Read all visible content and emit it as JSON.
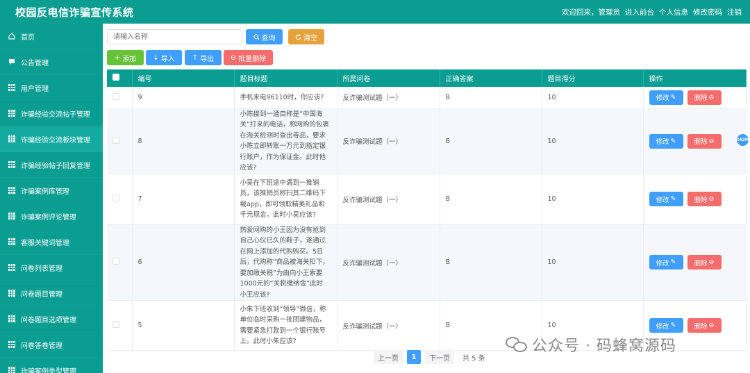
{
  "app": {
    "title": "校园反电信诈骗宣传系统"
  },
  "topnav": {
    "welcome": "欢迎回来，管理员",
    "links": [
      "进入前台",
      "个人信息",
      "修改密码",
      "注销"
    ]
  },
  "sidebar": {
    "items": [
      {
        "label": "首页",
        "icon": "home-icon"
      },
      {
        "label": "公告管理",
        "icon": "message-icon"
      },
      {
        "label": "用户管理",
        "icon": "grid-icon"
      },
      {
        "label": "诈骗经验交流帖子管理",
        "icon": "grid-icon"
      },
      {
        "label": "诈骗经验交流板块管理",
        "icon": "grid-icon"
      },
      {
        "label": "诈骗经验帖子回复管理",
        "icon": "grid-icon"
      },
      {
        "label": "诈骗案例库管理",
        "icon": "grid-icon"
      },
      {
        "label": "诈骗案例评论管理",
        "icon": "grid-icon"
      },
      {
        "label": "客服关键词管理",
        "icon": "grid-icon"
      },
      {
        "label": "问卷列表管理",
        "icon": "grid-icon"
      },
      {
        "label": "问卷题目管理",
        "icon": "grid-icon"
      },
      {
        "label": "问卷题目选项管理",
        "icon": "grid-icon"
      },
      {
        "label": "问卷答卷管理",
        "icon": "grid-icon"
      },
      {
        "label": "诈骗案例类型管理",
        "icon": "grid-icon"
      }
    ],
    "active_index": 4
  },
  "toolbar": {
    "search_placeholder": "请输入名称",
    "query_label": "查询",
    "clear_label": "清空",
    "add_label": "添加",
    "import_label": "导入",
    "export_label": "导出",
    "batch_delete_label": "批量删除"
  },
  "table": {
    "headers": [
      "编号",
      "题目标题",
      "所属问卷",
      "正确答案",
      "题目得分",
      "操作"
    ],
    "rows": [
      {
        "id": "9",
        "title": "手机来电96110时，你应该?",
        "survey": "反诈骗测试题（一）",
        "answer": "B",
        "score": "10"
      },
      {
        "id": "8",
        "title": "小陈接到一通自称是“中国海关”打来的电话，称网购的包裹在海关检测时查出毒品，要求小陈立即转账一万元到指定银行账户，作为保证金。此时他应该?",
        "survey": "反诈骗测试题（一）",
        "answer": "B",
        "score": "10"
      },
      {
        "id": "7",
        "title": "小吴在下班途中遇到一推销员，该推销员称扫其二维码下载app，即可领取精美礼品和千元现金，此时小吴应该?",
        "survey": "反诈骗测试题（一）",
        "answer": "B",
        "score": "10"
      },
      {
        "id": "6",
        "title": "热爱网购的小王因为没有抢到自己心仪已久的鞋子，遂通过在网上添加的代购购买。5日后，代购称“商品被海关扣下，要加缴关税”为由向小王索要1000元的“关税缴纳金”此时小王应该?",
        "survey": "反诈骗测试题（一）",
        "answer": "B",
        "score": "10"
      },
      {
        "id": "5",
        "title": "小朱下班收到“领导”微信，称单位临时采购一批团建物品，需要紧急打款到一个银行账号上。此时小朱应该?",
        "survey": "反诈骗测试题（一）",
        "answer": "B",
        "score": "10"
      }
    ],
    "edit_label": "修改",
    "delete_label": "删除"
  },
  "pagination": {
    "prev_label": "上一页",
    "current_page": "1",
    "next_label": "下一页",
    "total_label": "共 5 条"
  },
  "watermark": {
    "text": "公众号 · 码蜂窝源码"
  },
  "badge": {
    "text": "242M"
  },
  "colors": {
    "primary": "#0a9d92",
    "blue": "#409eff",
    "orange": "#e6a23c",
    "green": "#67c23a",
    "red": "#f56c6c"
  }
}
